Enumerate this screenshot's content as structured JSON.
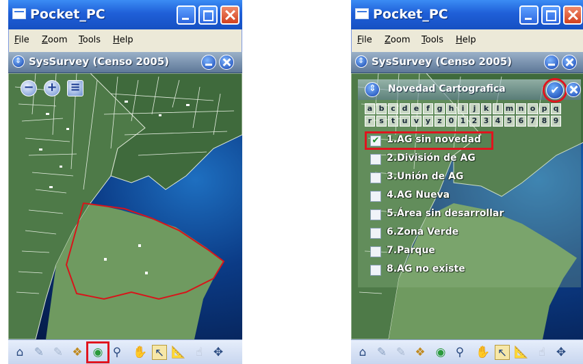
{
  "window": {
    "title": "Pocket_PC"
  },
  "menu": [
    "File",
    "Zoom",
    "Tools",
    "Help"
  ],
  "app": {
    "title": "SysSurvey (Censo 2005)"
  },
  "dialog": {
    "title": "Novedad Cartografica",
    "letters_row1": [
      "a",
      "b",
      "c",
      "d",
      "e",
      "f",
      "g",
      "h",
      "i",
      "j",
      "k",
      "l",
      "m",
      "n",
      "o",
      "p",
      "q"
    ],
    "letters_row2": [
      "r",
      "s",
      "t",
      "u",
      "v",
      "y",
      "z",
      "0",
      "1",
      "2",
      "3",
      "4",
      "5",
      "6",
      "7",
      "8",
      "9"
    ],
    "options": [
      {
        "label": "1.AG sin novedad",
        "checked": true
      },
      {
        "label": "2.División de AG",
        "checked": false
      },
      {
        "label": "3.Unión de AG",
        "checked": false
      },
      {
        "label": "4.AG Nueva",
        "checked": false
      },
      {
        "label": "5.Área sin desarrollar",
        "checked": false
      },
      {
        "label": "6.Zona Verde",
        "checked": false
      },
      {
        "label": "7.Parque",
        "checked": false
      },
      {
        "label": "8.AG no existe",
        "checked": false
      }
    ],
    "check_glyph": "✔"
  },
  "toolbar_icons": [
    "home-icon",
    "pen-icon",
    "pen-faded-icon",
    "layers-icon",
    "map-globe-icon",
    "magnifier-icon",
    "hand-icon",
    "select-arrow-icon",
    "measure-icon",
    "pointer-icon",
    "pan-icon"
  ],
  "colors": {
    "highlight": "#e0141e",
    "titlebar": "#1f5fd8",
    "map_land": "#6f9a60"
  }
}
